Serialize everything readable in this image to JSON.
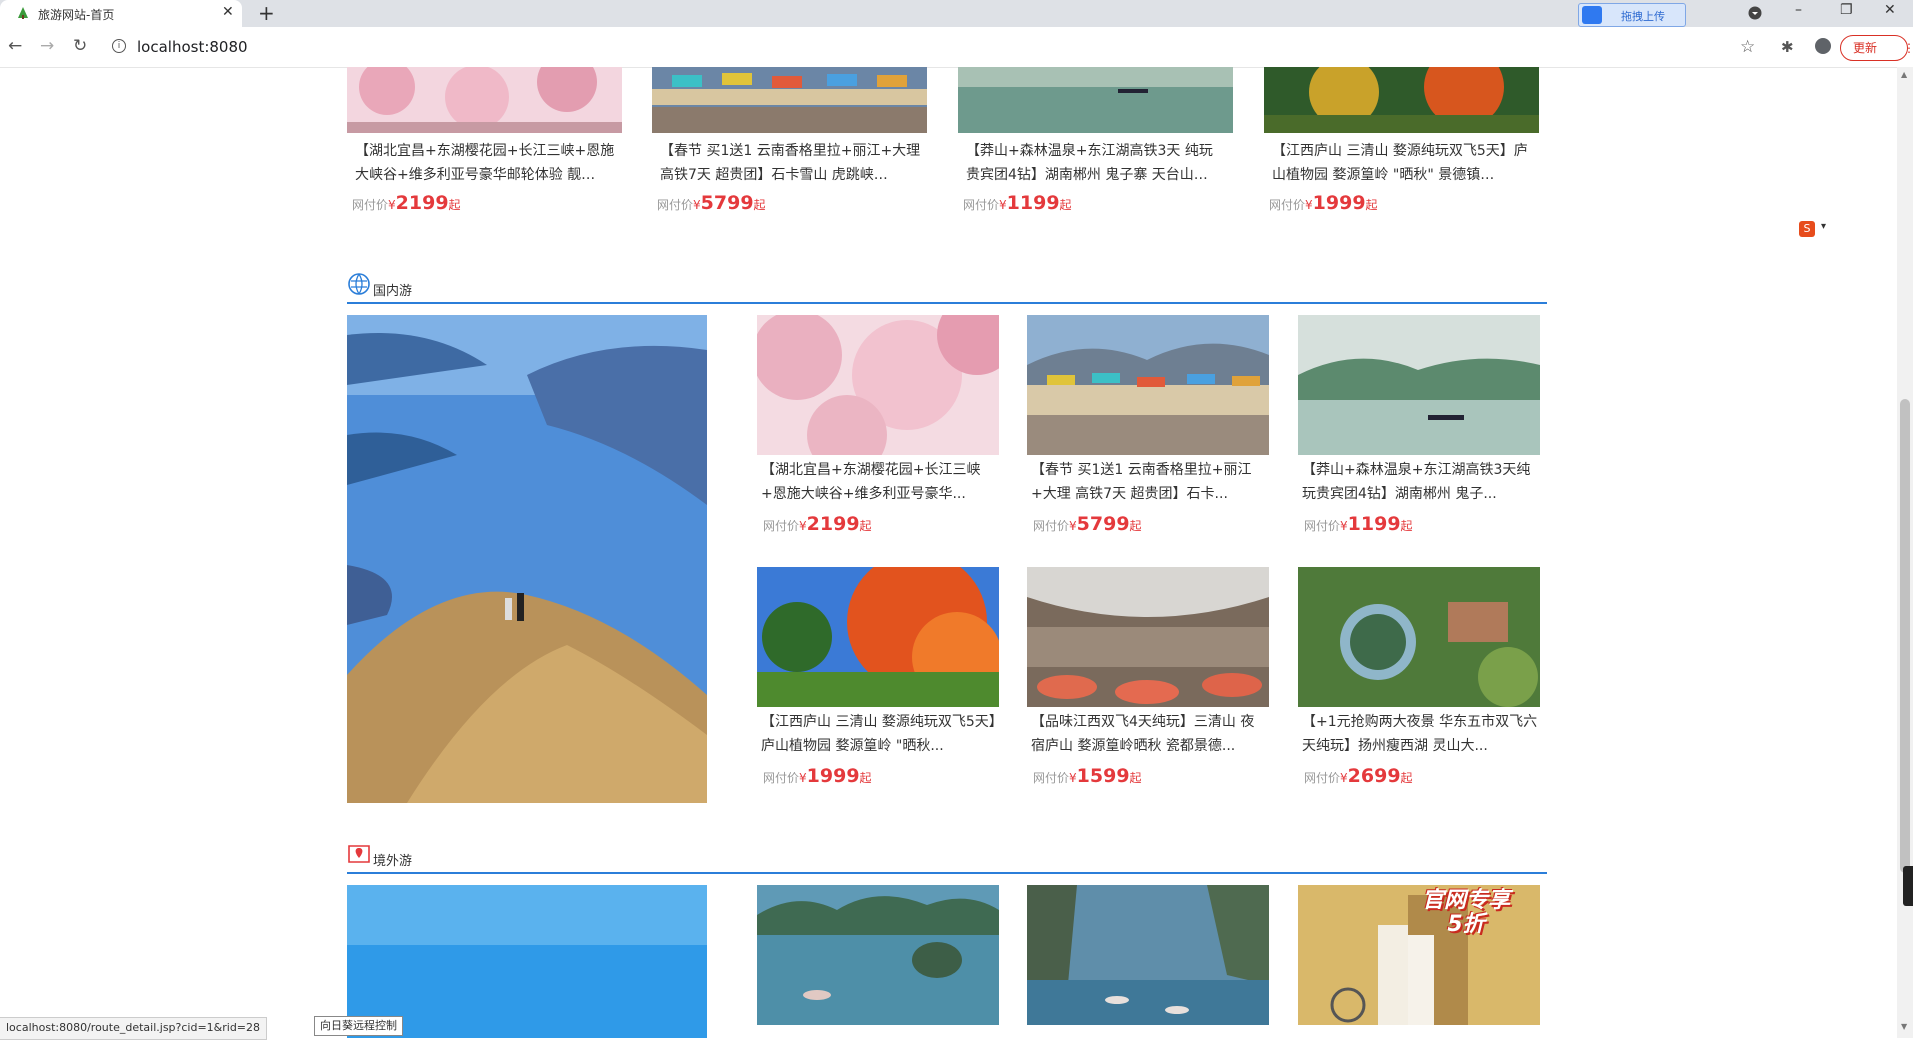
{
  "browser": {
    "tab_title": "旅游网站-首页",
    "tab_close": "✕",
    "new_tab": "+",
    "url": "localhost:8080",
    "ext_upload_label": "拖拽上传",
    "update_label": "更新",
    "update_menu": "⋮",
    "win_minimize": "–",
    "win_restore": "❐",
    "win_close": "✕",
    "back": "←",
    "forward": "→",
    "reload": "↻",
    "bookmark": "☆",
    "info": "i",
    "extensions": "✱"
  },
  "top_row": [
    {
      "title": "【湖北宜昌+东湖樱花园+长江三峡+恩施大峡谷+维多利亚号豪华邮轮体验 靓…",
      "price_label": "网付价",
      "price_cur": "¥",
      "price": "2199",
      "price_suffix": "起"
    },
    {
      "title": "【春节 买1送1 云南香格里拉+丽江+大理 高铁7天 超贵团】石卡雪山 虎跳峡…",
      "price_label": "网付价",
      "price_cur": "¥",
      "price": "5799",
      "price_suffix": "起"
    },
    {
      "title": "【莽山+森林温泉+东江湖高铁3天 纯玩 贵宾团4钻】湖南郴州 鬼子寨 天台山…",
      "price_label": "网付价",
      "price_cur": "¥",
      "price": "1199",
      "price_suffix": "起"
    },
    {
      "title": "【江西庐山 三清山 婺源纯玩双飞5天】庐山植物园 婺源篁岭 \"晒秋\" 景德镇…",
      "price_label": "网付价",
      "price_cur": "¥",
      "price": "1999",
      "price_suffix": "起"
    }
  ],
  "domestic": {
    "heading": "国内游",
    "cards": [
      {
        "title": "【湖北宜昌+东湖樱花园+长江三峡+恩施大峡谷+维多利亚号豪华...",
        "price_label": "网付价",
        "price_cur": "¥",
        "price": "2199",
        "price_suffix": "起"
      },
      {
        "title": "【春节 买1送1 云南香格里拉+丽江+大理 高铁7天 超贵团】石卡...",
        "price_label": "网付价",
        "price_cur": "¥",
        "price": "5799",
        "price_suffix": "起"
      },
      {
        "title": "【莽山+森林温泉+东江湖高铁3天纯玩贵宾团4钻】湖南郴州 鬼子...",
        "price_label": "网付价",
        "price_cur": "¥",
        "price": "1199",
        "price_suffix": "起"
      },
      {
        "title": "【江西庐山 三清山 婺源纯玩双飞5天】庐山植物园 婺源篁岭 \"晒秋...",
        "price_label": "网付价",
        "price_cur": "¥",
        "price": "1999",
        "price_suffix": "起"
      },
      {
        "title": "【品味江西双飞4天纯玩】三清山 夜宿庐山 婺源篁岭晒秋 瓷都景德...",
        "price_label": "网付价",
        "price_cur": "¥",
        "price": "1599",
        "price_suffix": "起"
      },
      {
        "title": "【+1元抢购两大夜景 华东五市双飞六天纯玩】扬州瘦西湖 灵山大...",
        "price_label": "网付价",
        "price_cur": "¥",
        "price": "2699",
        "price_suffix": "起"
      }
    ]
  },
  "overseas": {
    "heading": "境外游",
    "promo_badge_line1": "官网专享",
    "promo_badge_line2": "5折"
  },
  "status_url": "localhost:8080/route_detail.jsp?cid=1&rid=28",
  "remote_label": "向日葵远程控制",
  "side_widget_letter": "S",
  "colors": {
    "accent_blue": "#2b7ed9",
    "price_red": "#e4393c"
  }
}
